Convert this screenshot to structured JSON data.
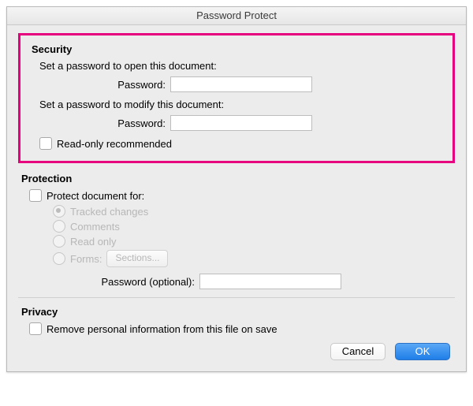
{
  "window": {
    "title": "Password Protect"
  },
  "security": {
    "heading": "Security",
    "open_prompt": "Set a password to open this document:",
    "open_password_label": "Password:",
    "open_password_value": "",
    "modify_prompt": "Set a password to modify this document:",
    "modify_password_label": "Password:",
    "modify_password_value": "",
    "readonly_label": "Read-only recommended"
  },
  "protection": {
    "heading": "Protection",
    "protect_for_label": "Protect document for:",
    "radios": {
      "tracked": "Tracked changes",
      "comments": "Comments",
      "readonly": "Read only",
      "forms": "Forms:"
    },
    "sections_button": "Sections...",
    "optional_password_label": "Password (optional):",
    "optional_password_value": ""
  },
  "privacy": {
    "heading": "Privacy",
    "remove_info_label": "Remove personal information from this file on save"
  },
  "buttons": {
    "cancel": "Cancel",
    "ok": "OK"
  }
}
